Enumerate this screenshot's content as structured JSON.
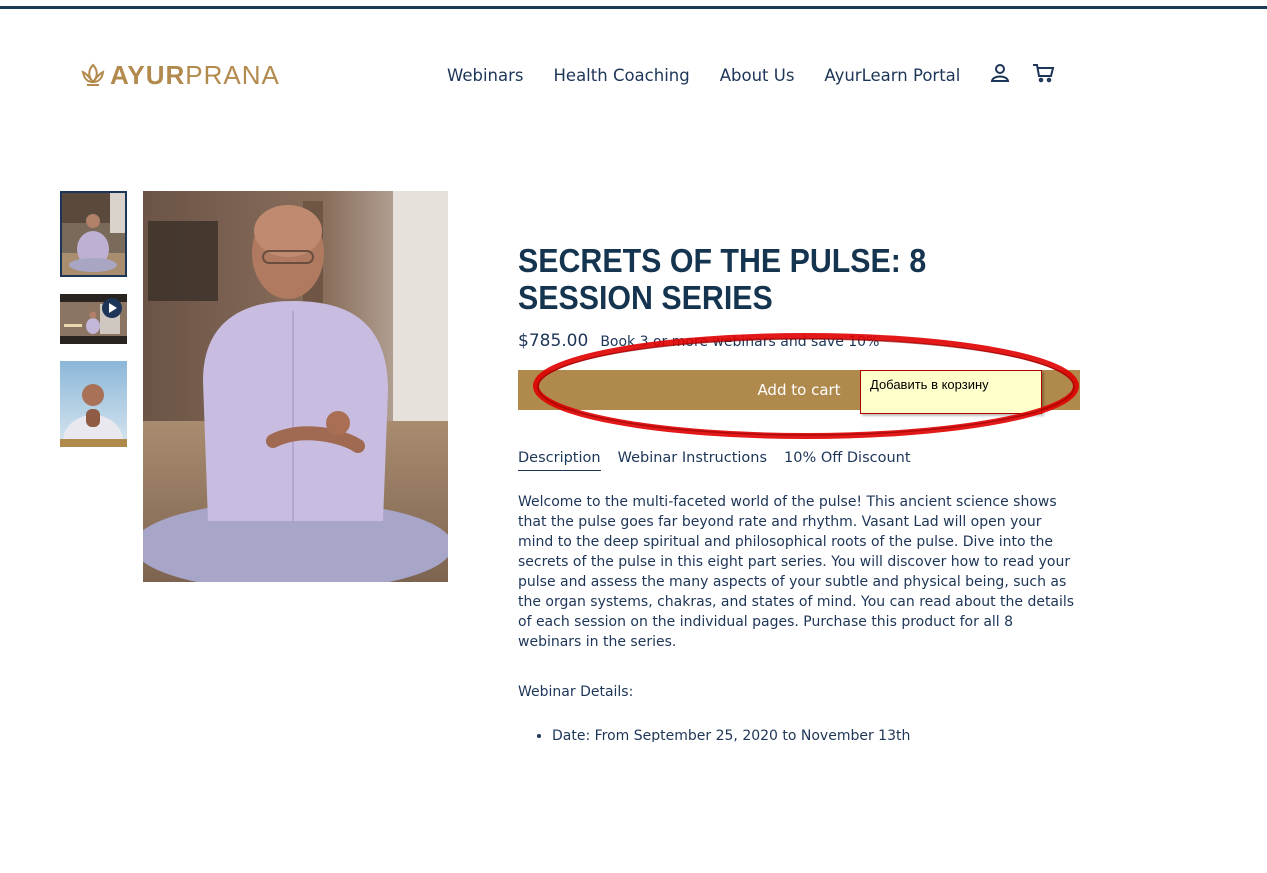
{
  "header": {
    "logo": {
      "bold": "AYUR",
      "light": "PRANA"
    },
    "nav": [
      {
        "label": "Webinars"
      },
      {
        "label": "Health Coaching"
      },
      {
        "label": "About Us"
      },
      {
        "label": "AyurLearn Portal"
      }
    ],
    "icons": [
      "account-icon",
      "cart-icon"
    ]
  },
  "product": {
    "title": "SECRETS OF THE PULSE: 8 SESSION SERIES",
    "price": "$785.00",
    "promo": "Book 3 or more webinars and save 10%",
    "add_to_cart": "Add to cart",
    "tooltip": "Добавить в корзину",
    "tabs": [
      "Description",
      "Webinar Instructions",
      "10% Off Discount"
    ],
    "active_tab": "Description",
    "description": "Welcome to the multi-faceted world of the pulse! This ancient science shows that the pulse goes far beyond rate and rhythm. Vasant Lad will open your mind to the deep spiritual and philosophical roots of the pulse. Dive into the secrets of the pulse in this eight part series. You will discover how to read your pulse and assess the many aspects of your subtle and physical being, such as the organ systems, chakras, and states of mind. You can read about the details of each session on the individual pages. Purchase this product for all 8 webinars in the series.",
    "details_label": "Webinar Details:",
    "details": [
      "Date: From September 25, 2020 to November 13th"
    ]
  },
  "colors": {
    "navy": "#1d3557",
    "gold": "#b08a4d",
    "annotation_red": "#e00000",
    "tooltip_bg": "#ffffcc"
  }
}
